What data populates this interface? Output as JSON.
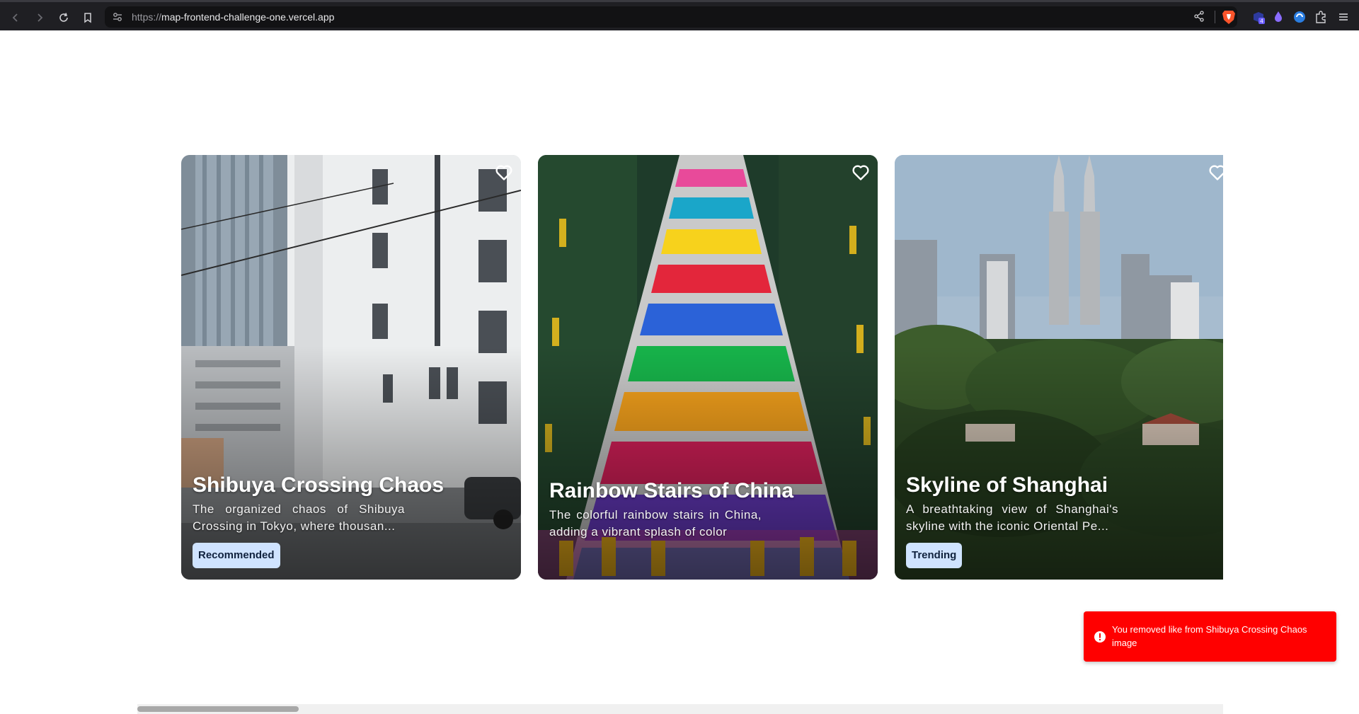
{
  "browser": {
    "url_protocol": "https://",
    "url_host": "map-frontend-challenge-one.vercel.app",
    "extension_badge": "4"
  },
  "cards": [
    {
      "title": "Shibuya Crossing Chaos",
      "description": "The organized chaos of Shibuya Crossing in Tokyo, where thousan...",
      "tag": "Recommended",
      "liked": false
    },
    {
      "title": "Rainbow Stairs of China",
      "description": "The colorful rainbow stairs in China, adding a vibrant splash of color",
      "tag": "",
      "liked": false
    },
    {
      "title": "Skyline of Shanghai",
      "description": "A breathtaking view of Shanghai's skyline with the iconic Oriental Pe...",
      "tag": "Trending",
      "liked": false
    }
  ],
  "toast": {
    "message": "You removed like from Shibuya Crossing Chaos image",
    "color": "#ff0000"
  }
}
